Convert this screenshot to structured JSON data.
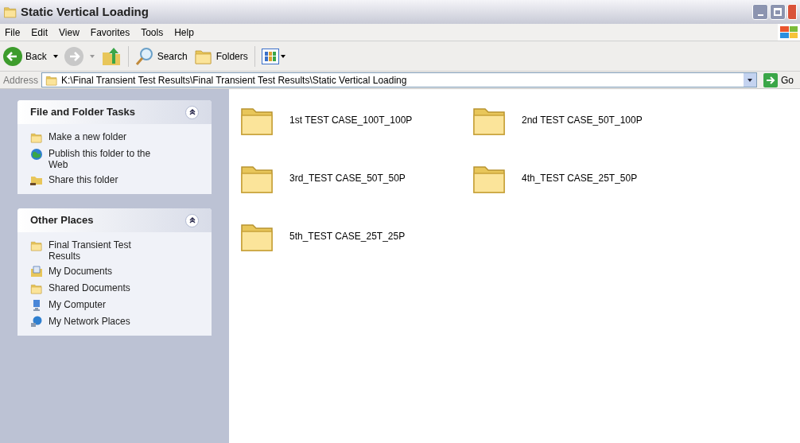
{
  "window": {
    "title": "Static Vertical Loading"
  },
  "menu": [
    "File",
    "Edit",
    "View",
    "Favorites",
    "Tools",
    "Help"
  ],
  "toolbar": {
    "back": "Back",
    "search": "Search",
    "folders": "Folders"
  },
  "address": {
    "label": "Address",
    "value": "K:\\Final Transient Test Results\\Final Transient Test Results\\Static Vertical Loading",
    "go": "Go"
  },
  "task_panels": [
    {
      "title": "File and Folder Tasks",
      "expanded": true,
      "items": [
        {
          "label": "Make a new folder",
          "kind": "new-folder"
        },
        {
          "label": "Publish this folder to the Web",
          "kind": "globe"
        },
        {
          "label": "Share this folder",
          "kind": "share"
        }
      ]
    },
    {
      "title": "Other Places",
      "expanded": true,
      "items": [
        {
          "label": "Final Transient Test Results",
          "kind": "folder"
        },
        {
          "label": "My Documents",
          "kind": "documents"
        },
        {
          "label": "Shared Documents",
          "kind": "folder"
        },
        {
          "label": "My Computer",
          "kind": "computer"
        },
        {
          "label": "My Network Places",
          "kind": "network"
        }
      ]
    }
  ],
  "folders": [
    "1st TEST CASE_100T_100P",
    "2nd TEST CASE_50T_100P",
    "3rd_TEST CASE_50T_50P",
    "4th_TEST CASE_25T_50P",
    "5th_TEST CASE_25T_25P"
  ]
}
